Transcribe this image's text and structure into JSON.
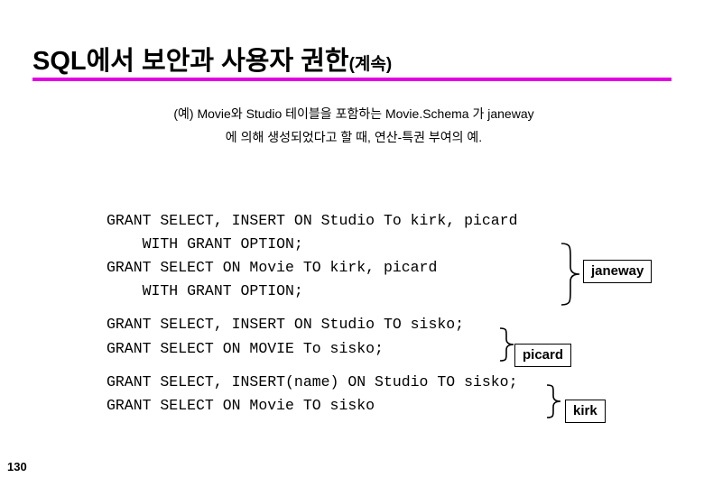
{
  "slide": {
    "title_main": "SQL에서 보안과 사용자 권한",
    "title_sub": "(계속)",
    "accent_color": "#e200e2",
    "intro_line1": "(예) Movie와 Studio 테이블을 포함하는 Movie.Schema 가 janeway",
    "intro_line2": "에 의해 생성되었다고 할 때, 연산-특권 부여의 예.",
    "page_number": "130",
    "code_lines": [
      "GRANT SELECT, INSERT ON Studio To kirk, picard",
      "    WITH GRANT OPTION;",
      "GRANT SELECT ON Movie TO kirk, picard",
      "    WITH GRANT OPTION;",
      "GRANT SELECT, INSERT ON Studio TO sisko;",
      "GRANT SELECT ON MOVIE To sisko;",
      "GRANT SELECT, INSERT(name) ON Studio TO sisko;",
      "GRANT SELECT ON Movie TO sisko"
    ],
    "annotations": [
      {
        "label": "janeway"
      },
      {
        "label": "picard"
      },
      {
        "label": "kirk"
      }
    ]
  }
}
